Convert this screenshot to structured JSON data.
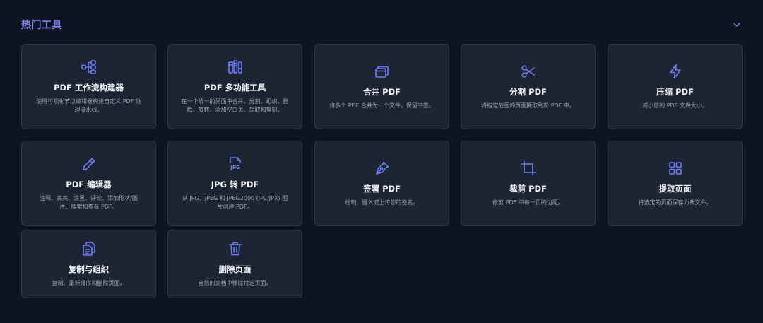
{
  "section": {
    "title": "热门工具"
  },
  "colors": {
    "accent": "#6f7cf4",
    "card_bg": "#1d2533",
    "page_bg": "#0f1422"
  },
  "tools": [
    {
      "title": "PDF 工作流构建器",
      "desc": "使用可视化节点编辑器构建自定义 PDF 处理流水线。",
      "icon": "workflow-icon"
    },
    {
      "title": "PDF 多功能工具",
      "desc": "在一个统一的界面中合并、分割、组织、删除、旋转、添加空白页、提取和复制。",
      "icon": "multitool-icon"
    },
    {
      "title": "合并 PDF",
      "desc": "将多个 PDF 合并为一个文件。保留书签。",
      "icon": "merge-icon"
    },
    {
      "title": "分割 PDF",
      "desc": "将指定范围的页面提取到新 PDF 中。",
      "icon": "scissors-icon"
    },
    {
      "title": "压缩 PDF",
      "desc": "减小您的 PDF 文件大小。",
      "icon": "lightning-icon"
    },
    {
      "title": "PDF 编辑器",
      "desc": "注释、高亮、涂黑、评论、添加形状/图片、搜索和查看 PDF。",
      "icon": "pencil-icon"
    },
    {
      "title": "JPG 转 PDF",
      "desc": "从 JPG、JPEG 和 JPEG2000 (JP2/JPX) 图片创建 PDF。",
      "icon": "jpg-file-icon"
    },
    {
      "title": "签署 PDF",
      "desc": "绘制、键入或上传您的签名。",
      "icon": "pen-nib-icon"
    },
    {
      "title": "裁剪 PDF",
      "desc": "修剪 PDF 中每一页的边距。",
      "icon": "crop-icon"
    },
    {
      "title": "提取页面",
      "desc": "将选定的页面保存为新文件。",
      "icon": "grid-icon"
    },
    {
      "title": "复制与组织",
      "desc": "复制、重新排序和删除页面。",
      "icon": "copy-pages-icon"
    },
    {
      "title": "删除页面",
      "desc": "自您的文档中移除特定页面。",
      "icon": "trash-icon"
    }
  ]
}
